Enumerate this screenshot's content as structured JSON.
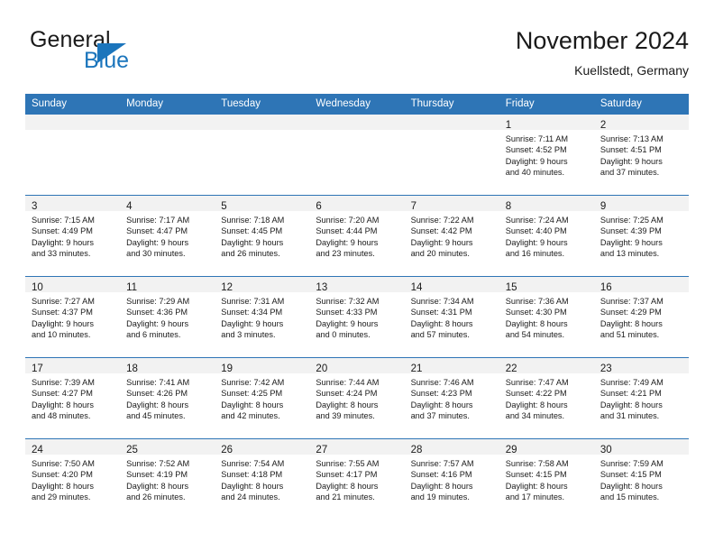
{
  "brand": {
    "name_part1": "General",
    "name_part2": "Blue",
    "accent_color": "#1b75bc"
  },
  "header": {
    "title": "November 2024",
    "subtitle": "Kuellstedt, Germany"
  },
  "theme": {
    "header_row_color": "#2e75b6",
    "daynum_band_color": "#f2f2f2",
    "text_color": "#1a1a1a"
  },
  "weekday_headers": [
    "Sunday",
    "Monday",
    "Tuesday",
    "Wednesday",
    "Thursday",
    "Friday",
    "Saturday"
  ],
  "weeks": [
    [
      {
        "day": "",
        "lines": []
      },
      {
        "day": "",
        "lines": []
      },
      {
        "day": "",
        "lines": []
      },
      {
        "day": "",
        "lines": []
      },
      {
        "day": "",
        "lines": []
      },
      {
        "day": "1",
        "lines": [
          "Sunrise: 7:11 AM",
          "Sunset: 4:52 PM",
          "Daylight: 9 hours",
          "and 40 minutes."
        ]
      },
      {
        "day": "2",
        "lines": [
          "Sunrise: 7:13 AM",
          "Sunset: 4:51 PM",
          "Daylight: 9 hours",
          "and 37 minutes."
        ]
      }
    ],
    [
      {
        "day": "3",
        "lines": [
          "Sunrise: 7:15 AM",
          "Sunset: 4:49 PM",
          "Daylight: 9 hours",
          "and 33 minutes."
        ]
      },
      {
        "day": "4",
        "lines": [
          "Sunrise: 7:17 AM",
          "Sunset: 4:47 PM",
          "Daylight: 9 hours",
          "and 30 minutes."
        ]
      },
      {
        "day": "5",
        "lines": [
          "Sunrise: 7:18 AM",
          "Sunset: 4:45 PM",
          "Daylight: 9 hours",
          "and 26 minutes."
        ]
      },
      {
        "day": "6",
        "lines": [
          "Sunrise: 7:20 AM",
          "Sunset: 4:44 PM",
          "Daylight: 9 hours",
          "and 23 minutes."
        ]
      },
      {
        "day": "7",
        "lines": [
          "Sunrise: 7:22 AM",
          "Sunset: 4:42 PM",
          "Daylight: 9 hours",
          "and 20 minutes."
        ]
      },
      {
        "day": "8",
        "lines": [
          "Sunrise: 7:24 AM",
          "Sunset: 4:40 PM",
          "Daylight: 9 hours",
          "and 16 minutes."
        ]
      },
      {
        "day": "9",
        "lines": [
          "Sunrise: 7:25 AM",
          "Sunset: 4:39 PM",
          "Daylight: 9 hours",
          "and 13 minutes."
        ]
      }
    ],
    [
      {
        "day": "10",
        "lines": [
          "Sunrise: 7:27 AM",
          "Sunset: 4:37 PM",
          "Daylight: 9 hours",
          "and 10 minutes."
        ]
      },
      {
        "day": "11",
        "lines": [
          "Sunrise: 7:29 AM",
          "Sunset: 4:36 PM",
          "Daylight: 9 hours",
          "and 6 minutes."
        ]
      },
      {
        "day": "12",
        "lines": [
          "Sunrise: 7:31 AM",
          "Sunset: 4:34 PM",
          "Daylight: 9 hours",
          "and 3 minutes."
        ]
      },
      {
        "day": "13",
        "lines": [
          "Sunrise: 7:32 AM",
          "Sunset: 4:33 PM",
          "Daylight: 9 hours",
          "and 0 minutes."
        ]
      },
      {
        "day": "14",
        "lines": [
          "Sunrise: 7:34 AM",
          "Sunset: 4:31 PM",
          "Daylight: 8 hours",
          "and 57 minutes."
        ]
      },
      {
        "day": "15",
        "lines": [
          "Sunrise: 7:36 AM",
          "Sunset: 4:30 PM",
          "Daylight: 8 hours",
          "and 54 minutes."
        ]
      },
      {
        "day": "16",
        "lines": [
          "Sunrise: 7:37 AM",
          "Sunset: 4:29 PM",
          "Daylight: 8 hours",
          "and 51 minutes."
        ]
      }
    ],
    [
      {
        "day": "17",
        "lines": [
          "Sunrise: 7:39 AM",
          "Sunset: 4:27 PM",
          "Daylight: 8 hours",
          "and 48 minutes."
        ]
      },
      {
        "day": "18",
        "lines": [
          "Sunrise: 7:41 AM",
          "Sunset: 4:26 PM",
          "Daylight: 8 hours",
          "and 45 minutes."
        ]
      },
      {
        "day": "19",
        "lines": [
          "Sunrise: 7:42 AM",
          "Sunset: 4:25 PM",
          "Daylight: 8 hours",
          "and 42 minutes."
        ]
      },
      {
        "day": "20",
        "lines": [
          "Sunrise: 7:44 AM",
          "Sunset: 4:24 PM",
          "Daylight: 8 hours",
          "and 39 minutes."
        ]
      },
      {
        "day": "21",
        "lines": [
          "Sunrise: 7:46 AM",
          "Sunset: 4:23 PM",
          "Daylight: 8 hours",
          "and 37 minutes."
        ]
      },
      {
        "day": "22",
        "lines": [
          "Sunrise: 7:47 AM",
          "Sunset: 4:22 PM",
          "Daylight: 8 hours",
          "and 34 minutes."
        ]
      },
      {
        "day": "23",
        "lines": [
          "Sunrise: 7:49 AM",
          "Sunset: 4:21 PM",
          "Daylight: 8 hours",
          "and 31 minutes."
        ]
      }
    ],
    [
      {
        "day": "24",
        "lines": [
          "Sunrise: 7:50 AM",
          "Sunset: 4:20 PM",
          "Daylight: 8 hours",
          "and 29 minutes."
        ]
      },
      {
        "day": "25",
        "lines": [
          "Sunrise: 7:52 AM",
          "Sunset: 4:19 PM",
          "Daylight: 8 hours",
          "and 26 minutes."
        ]
      },
      {
        "day": "26",
        "lines": [
          "Sunrise: 7:54 AM",
          "Sunset: 4:18 PM",
          "Daylight: 8 hours",
          "and 24 minutes."
        ]
      },
      {
        "day": "27",
        "lines": [
          "Sunrise: 7:55 AM",
          "Sunset: 4:17 PM",
          "Daylight: 8 hours",
          "and 21 minutes."
        ]
      },
      {
        "day": "28",
        "lines": [
          "Sunrise: 7:57 AM",
          "Sunset: 4:16 PM",
          "Daylight: 8 hours",
          "and 19 minutes."
        ]
      },
      {
        "day": "29",
        "lines": [
          "Sunrise: 7:58 AM",
          "Sunset: 4:15 PM",
          "Daylight: 8 hours",
          "and 17 minutes."
        ]
      },
      {
        "day": "30",
        "lines": [
          "Sunrise: 7:59 AM",
          "Sunset: 4:15 PM",
          "Daylight: 8 hours",
          "and 15 minutes."
        ]
      }
    ]
  ]
}
